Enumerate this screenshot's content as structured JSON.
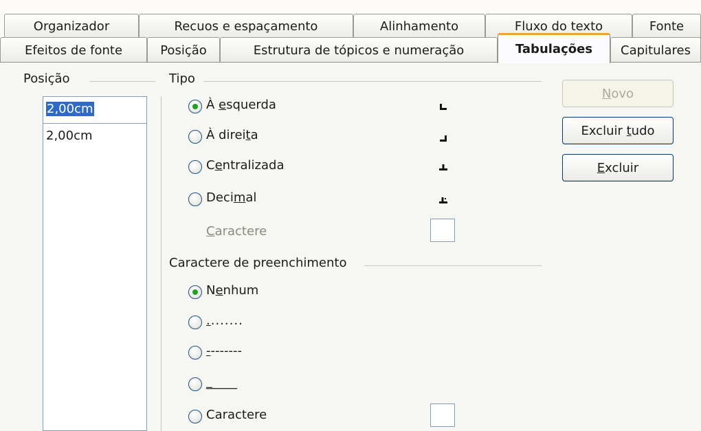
{
  "tabs_row1": [
    "Organizador",
    "Recuos e espaçamento",
    "Alinhamento",
    "Fluxo do texto",
    "Fonte"
  ],
  "tabs_row2": [
    "Efeitos de fonte",
    "Posição",
    "Estrutura de tópicos e numeração",
    "Tabulações",
    "Capitulares"
  ],
  "active_tab": "Tabulações",
  "position": {
    "label": "Posição",
    "input_value": "2,00cm",
    "list": [
      "2,00cm"
    ]
  },
  "type": {
    "label": "Tipo",
    "options": [
      {
        "pre": "À ",
        "u": "e",
        "post": "squerda",
        "checked": true,
        "icon": "left-tab-icon"
      },
      {
        "pre": "À direi",
        "u": "t",
        "post": "a",
        "checked": false,
        "icon": "right-tab-icon"
      },
      {
        "pre": "C",
        "u": "e",
        "post": "ntralizada",
        "checked": false,
        "icon": "center-tab-icon"
      },
      {
        "pre": "Deci",
        "u": "m",
        "post": "al",
        "checked": false,
        "icon": "decimal-tab-icon"
      }
    ],
    "character": {
      "u": "C",
      "post": "aractere"
    }
  },
  "fill": {
    "label": "Caractere de preenchimento",
    "options": [
      {
        "pre": "N",
        "u": "e",
        "post": "nhum",
        "checked": true
      },
      {
        "pre": "",
        "u": ".",
        "post": ".......",
        "checked": false
      },
      {
        "pre": "",
        "u": "-",
        "post": "-------",
        "checked": false
      },
      {
        "pre": "",
        "u": "_",
        "post": "____",
        "checked": false
      },
      {
        "pre": "Caractere",
        "u": "",
        "post": "",
        "checked": false
      }
    ]
  },
  "buttons": {
    "new": {
      "u": "N",
      "post": "ovo"
    },
    "delete_all": {
      "pre": "Excluir ",
      "u": "t",
      "post": "udo"
    },
    "delete": {
      "u": "E",
      "post": "xcluir"
    }
  },
  "colors": {
    "accent_tab": "#f0a430",
    "radio_check": "#21a121",
    "selection": "#316ac5"
  }
}
